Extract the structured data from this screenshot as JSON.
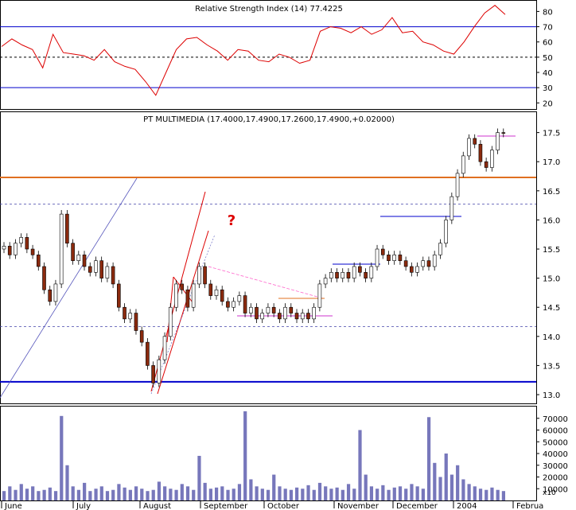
{
  "chart_data": [
    {
      "panel": "rsi",
      "type": "line",
      "title": "Relative Strength Index (14) 77.4225",
      "y_ticks": [
        20,
        30,
        40,
        50,
        60,
        70,
        80
      ],
      "ylim": [
        16,
        87
      ],
      "reference_lines": [
        {
          "value": 70,
          "style": "solid",
          "color": "#0000cc"
        },
        {
          "value": 50,
          "style": "dashed",
          "color": "#000000"
        },
        {
          "value": 30,
          "style": "solid",
          "color": "#0000cc"
        }
      ],
      "x": [
        0,
        3,
        6,
        9,
        12,
        15,
        18,
        21,
        24,
        27,
        30,
        33,
        36,
        39,
        42,
        45,
        48,
        51,
        54,
        57,
        60,
        63,
        66,
        69,
        72,
        75,
        78,
        81,
        84,
        87,
        90,
        93,
        96,
        99,
        102,
        105,
        108,
        111,
        114,
        117,
        120,
        123,
        126,
        129,
        132,
        135,
        138,
        141,
        144,
        147
      ],
      "values": [
        57,
        62,
        58,
        55,
        43,
        65,
        53,
        52,
        51,
        48,
        55,
        47,
        44,
        42,
        34,
        25,
        40,
        55,
        62,
        63,
        58,
        54,
        48,
        55,
        54,
        48,
        47,
        52,
        50,
        46,
        48,
        67,
        70,
        69,
        66,
        70,
        65,
        68,
        76,
        66,
        67,
        60,
        58,
        54,
        52,
        60,
        70,
        79,
        84,
        78
      ],
      "series_color": "#dd0000"
    },
    {
      "panel": "price",
      "type": "candlestick",
      "title": "PT MULTIMEDIA (17.4000,17.4900,17.2600,17.4900,+0.02000)",
      "y_ticks": [
        13.0,
        13.5,
        14.0,
        14.5,
        15.0,
        15.5,
        16.0,
        16.5,
        17.0,
        17.5
      ],
      "ylim": [
        12.85,
        17.85
      ],
      "reference_lines": [
        {
          "value": 16.73,
          "style": "solid",
          "color": "#e07020"
        },
        {
          "value": 16.27,
          "style": "dashed",
          "color": "#4444aa"
        },
        {
          "value": 14.17,
          "style": "dashed",
          "color": "#4444aa"
        },
        {
          "value": 13.22,
          "style": "solid",
          "color": "#0000cc"
        }
      ],
      "annotation": "?",
      "closes": [
        15.55,
        15.4,
        15.6,
        15.7,
        15.5,
        15.4,
        15.2,
        14.8,
        14.6,
        14.9,
        16.1,
        15.6,
        15.3,
        15.4,
        15.2,
        15.1,
        15.3,
        15.0,
        15.2,
        14.9,
        14.5,
        14.3,
        14.4,
        14.1,
        13.9,
        13.5,
        13.2,
        13.6,
        14.0,
        14.5,
        14.9,
        14.8,
        14.5,
        14.9,
        15.2,
        14.9,
        14.7,
        14.8,
        14.6,
        14.5,
        14.6,
        14.7,
        14.4,
        14.5,
        14.3,
        14.4,
        14.5,
        14.4,
        14.3,
        14.5,
        14.4,
        14.3,
        14.4,
        14.3,
        14.5,
        14.9,
        15.0,
        15.1,
        15.0,
        15.1,
        15.0,
        15.2,
        15.1,
        15.0,
        15.2,
        15.5,
        15.4,
        15.3,
        15.4,
        15.3,
        15.2,
        15.1,
        15.2,
        15.3,
        15.2,
        15.4,
        15.6,
        16.0,
        16.4,
        16.8,
        17.1,
        17.4,
        17.3,
        17.0,
        16.9,
        17.2,
        17.5,
        17.49
      ]
    },
    {
      "panel": "volume",
      "type": "bar",
      "y_ticks": [
        10000,
        20000,
        30000,
        40000,
        50000,
        60000,
        70000
      ],
      "ylim": [
        0,
        80000
      ],
      "unit_label": "x10",
      "series_color": "#7777bb",
      "values": [
        8000,
        12000,
        9000,
        14000,
        10000,
        12000,
        8000,
        9000,
        11000,
        8000,
        72000,
        30000,
        12000,
        9000,
        15000,
        8000,
        10000,
        12000,
        8000,
        9000,
        14000,
        11000,
        9000,
        12000,
        10000,
        8000,
        9000,
        16000,
        12000,
        10000,
        9000,
        14000,
        12000,
        9000,
        38000,
        15000,
        10000,
        11000,
        12000,
        9000,
        10000,
        14000,
        76000,
        18000,
        12000,
        10000,
        9000,
        22000,
        12000,
        10000,
        9000,
        11000,
        10000,
        13000,
        9000,
        15000,
        12000,
        10000,
        11000,
        9000,
        14000,
        10000,
        60000,
        22000,
        12000,
        10000,
        13000,
        9000,
        11000,
        12000,
        10000,
        14000,
        12000,
        10000,
        71000,
        32000,
        20000,
        40000,
        22000,
        30000,
        18000,
        14000,
        12000,
        10000,
        9000,
        11000,
        9000,
        8000
      ],
      "x_labels": [
        "June",
        "July",
        "August",
        "September",
        "October",
        "November",
        "December",
        "2004",
        "Februa"
      ]
    }
  ]
}
